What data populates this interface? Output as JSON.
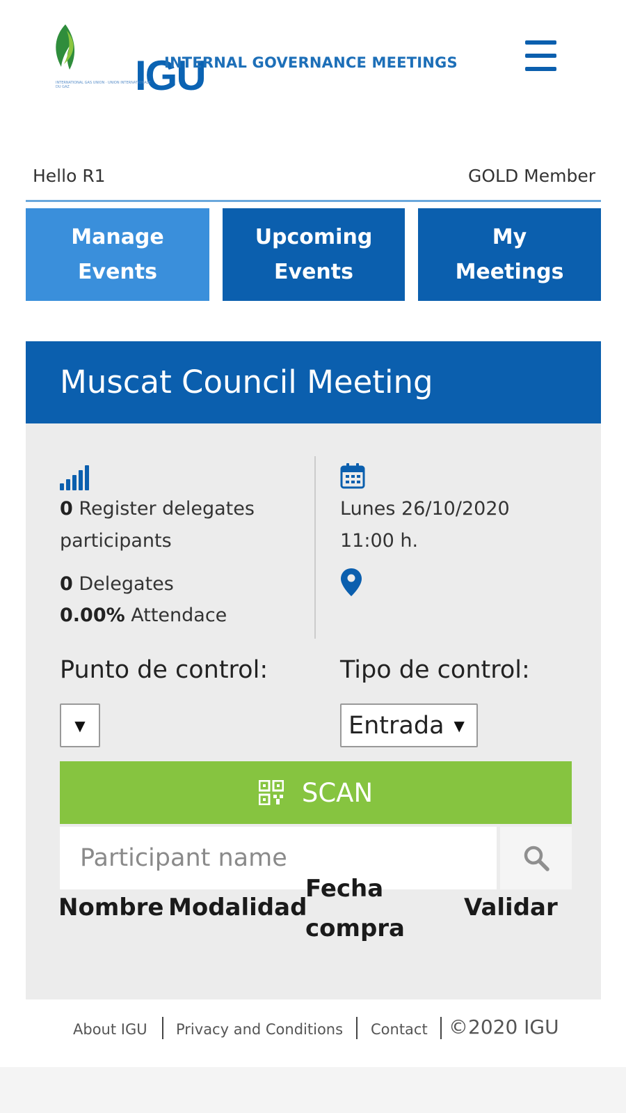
{
  "header": {
    "logo_text": "IGU",
    "logo_tagline": "INTERNATIONAL GAS UNION · UNION INTERNATIONALE DU GAZ",
    "site_title": "INTERNAL GOVERNANCE MEETINGS",
    "menu_icon": "hamburger-menu-icon"
  },
  "user": {
    "greeting": "Hello R1",
    "membership": "GOLD Member"
  },
  "nav": {
    "tabs": [
      {
        "line1": "Manage",
        "line2": "Events"
      },
      {
        "line1": "Upcoming",
        "line2": "Events"
      },
      {
        "line1": "My",
        "line2": "Meetings"
      }
    ]
  },
  "event": {
    "title": "Muscat Council Meeting",
    "stats": {
      "register_count": "0",
      "register_label": "Register delegates",
      "register_label_2": "participants",
      "delegates_count": "0",
      "delegates_label": "Delegates",
      "attendance_value": "0.00%",
      "attendance_label": "Attendace"
    },
    "date_line": "Lunes 26/10/2020",
    "time_line": "11:00 h."
  },
  "controls": {
    "punto_label": "Punto de control:",
    "punto_value": "",
    "tipo_label": "Tipo de control:",
    "tipo_value": "Entrada",
    "caret": "▼"
  },
  "scan": {
    "label": "SCAN",
    "color": "#86c440"
  },
  "search": {
    "placeholder": "Participant name",
    "value": ""
  },
  "table": {
    "headers": [
      "Nombre",
      "Modalidad",
      "Fecha compra",
      "Validar"
    ],
    "fecha_line1": "Fecha",
    "fecha_line2": "compra",
    "rows": []
  },
  "footer": {
    "links": [
      "About IGU",
      "Privacy and Conditions",
      "Contact"
    ],
    "copyright": "©2020 IGU"
  },
  "colors": {
    "primary": "#0b5fae",
    "active_tab": "#3a8fdb",
    "scan_green": "#86c440",
    "card_bg": "#ececec"
  }
}
